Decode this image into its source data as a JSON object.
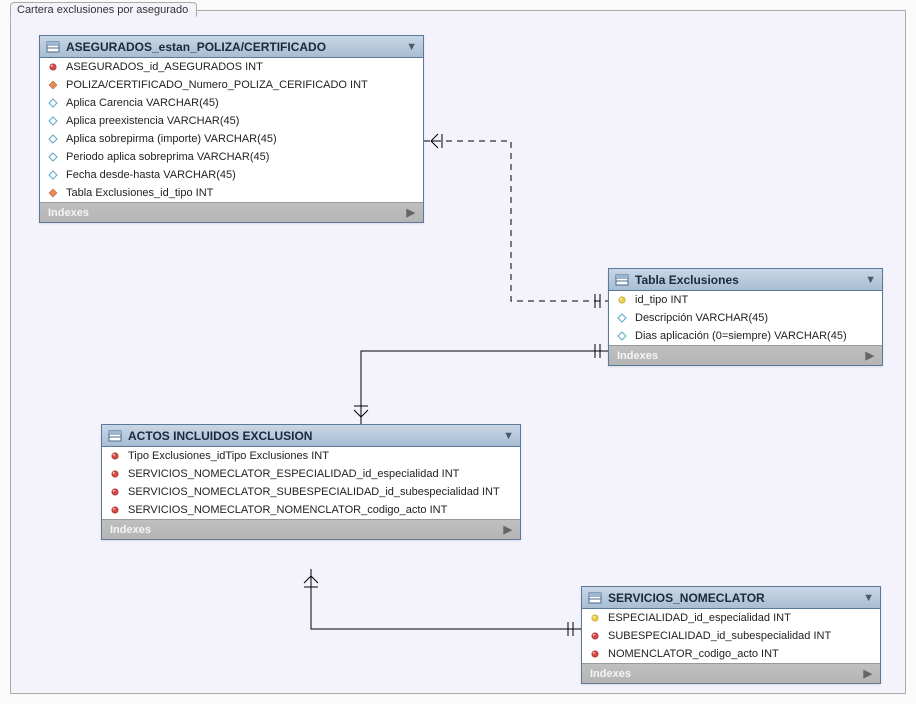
{
  "canvas": {
    "title": "Cartera exclusiones por asegurado"
  },
  "indexes_label": "Indexes",
  "tables": {
    "asegurados": {
      "title": "ASEGURADOS_estan_POLIZA/CERTIFICADO",
      "cols": [
        {
          "name": "ASEGURADOS_id_ASEGURADOS INT",
          "icon": "pk-red"
        },
        {
          "name": "POLIZA/CERTIFICADO_Numero_POLIZA_CERIFICADO INT",
          "icon": "fk-red"
        },
        {
          "name": "Aplica Carencia VARCHAR(45)",
          "icon": "attr"
        },
        {
          "name": "Aplica preexistencia VARCHAR(45)",
          "icon": "attr"
        },
        {
          "name": "Aplica sobrepirma (importe) VARCHAR(45)",
          "icon": "attr"
        },
        {
          "name": "Periodo aplica sobreprima VARCHAR(45)",
          "icon": "attr"
        },
        {
          "name": "Fecha desde-hasta VARCHAR(45)",
          "icon": "attr"
        },
        {
          "name": "Tabla Exclusiones_id_tipo INT",
          "icon": "fk-red"
        }
      ]
    },
    "tabla_exclusiones": {
      "title": "Tabla Exclusiones",
      "cols": [
        {
          "name": "id_tipo INT",
          "icon": "pk-yellow"
        },
        {
          "name": "Descripción VARCHAR(45)",
          "icon": "attr"
        },
        {
          "name": "Dias aplicación (0=siempre) VARCHAR(45)",
          "icon": "attr"
        }
      ]
    },
    "actos": {
      "title": "ACTOS INCLUIDOS EXCLUSION",
      "cols": [
        {
          "name": "Tipo Exclusiones_idTipo Exclusiones INT",
          "icon": "pk-red"
        },
        {
          "name": "SERVICIOS_NOMECLATOR_ESPECIALIDAD_id_especialidad INT",
          "icon": "pk-red"
        },
        {
          "name": "SERVICIOS_NOMECLATOR_SUBESPECIALIDAD_id_subespecialidad INT",
          "icon": "pk-red"
        },
        {
          "name": "SERVICIOS_NOMECLATOR_NOMENCLATOR_codigo_acto INT",
          "icon": "pk-red"
        }
      ]
    },
    "servicios": {
      "title": "SERVICIOS_NOMECLATOR",
      "cols": [
        {
          "name": "ESPECIALIDAD_id_especialidad INT",
          "icon": "pk-yellow"
        },
        {
          "name": "SUBESPECIALIDAD_id_subespecialidad INT",
          "icon": "pk-red"
        },
        {
          "name": "NOMENCLATOR_codigo_acto INT",
          "icon": "pk-red"
        }
      ]
    }
  }
}
